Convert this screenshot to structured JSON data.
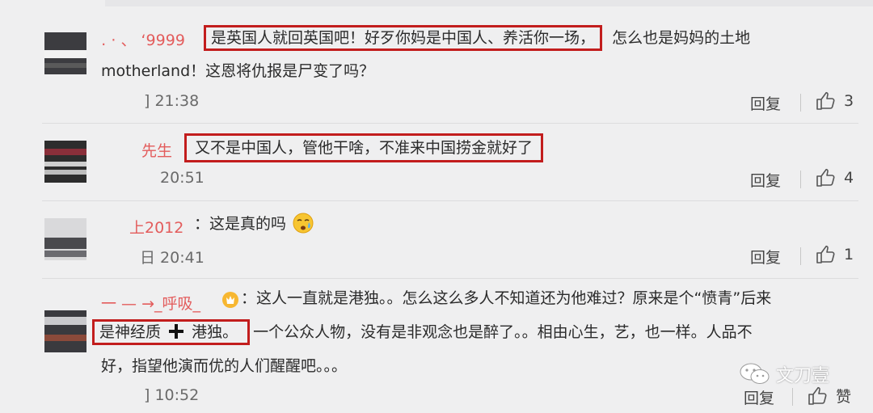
{
  "comments": [
    {
      "username": "․ · 、 ‘9999",
      "highlighted": "是英国人就回英国吧！好歹你妈是中国人、养活你一场，",
      "text_after": "怎么也是妈妈的土地",
      "text_line2": "motherland！这恩将仇报是尸变了吗？",
      "time": "] 21:38",
      "reply": "回复",
      "likes": "3"
    },
    {
      "username": "先生",
      "highlighted": "又不是中国人，管他干啥，不准来中国捞金就好了",
      "time": "20:51",
      "reply": "回复",
      "likes": "4"
    },
    {
      "username": "上2012",
      "text": "：这是真的吗",
      "emoji": "crying-face-icon",
      "time": "日 20:41",
      "reply": "回复",
      "likes": "1"
    },
    {
      "username": "一 — →_呼吸_",
      "text_line1": "：这人一直就是港独。。怎么这么多人不知道还为他难过？原来是个“愤青”后来",
      "highlighted_a": "是神经质",
      "highlighted_b": "港独。",
      "text_after": "一个公众人物，没有是非观念也是醉了。。相由心生，艺，也一样。人品不",
      "text_line3": "好，指望他演而优的人们醒醒吧。。。",
      "time": "] 10:52",
      "reply": "回复",
      "likes": "赞"
    }
  ],
  "watermark": {
    "text": "文刀壹",
    "icon": "wechat-icon"
  },
  "colors": {
    "background": "#efeff0",
    "username": "#e35c5c",
    "highlight_border": "#c21d1d",
    "text": "#2b2b2b",
    "meta": "#6a6a6a"
  }
}
